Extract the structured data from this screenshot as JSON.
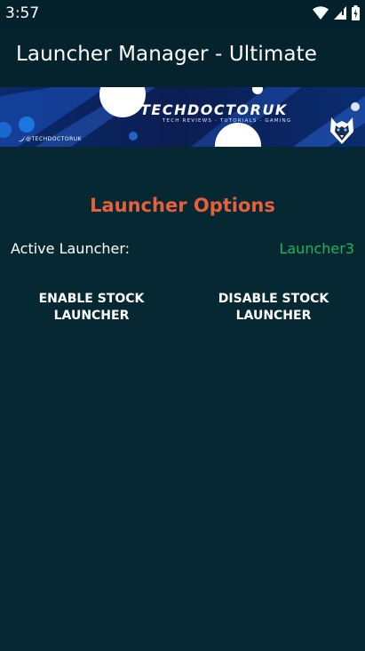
{
  "status_bar": {
    "time": "3:57",
    "icons": [
      "wifi-icon",
      "signal-icon",
      "battery-icon"
    ]
  },
  "app_bar": {
    "title": "Launcher Manager - Ultimate"
  },
  "banner": {
    "title": "TECHDOCTORUK",
    "subtitle": "TECH REVIEWS · TUTORIALS · GAMING",
    "handle": "@TECHDOCTORUK"
  },
  "options": {
    "section_title": "Launcher Options",
    "active_label": "Active Launcher:",
    "active_value": "Launcher3",
    "enable_button": "ENABLE STOCK\nLAUNCHER",
    "disable_button": "DISABLE STOCK\nLAUNCHER"
  },
  "colors": {
    "background": "#062833",
    "accent_orange": "#e5603b",
    "active_green": "#21b35a"
  }
}
